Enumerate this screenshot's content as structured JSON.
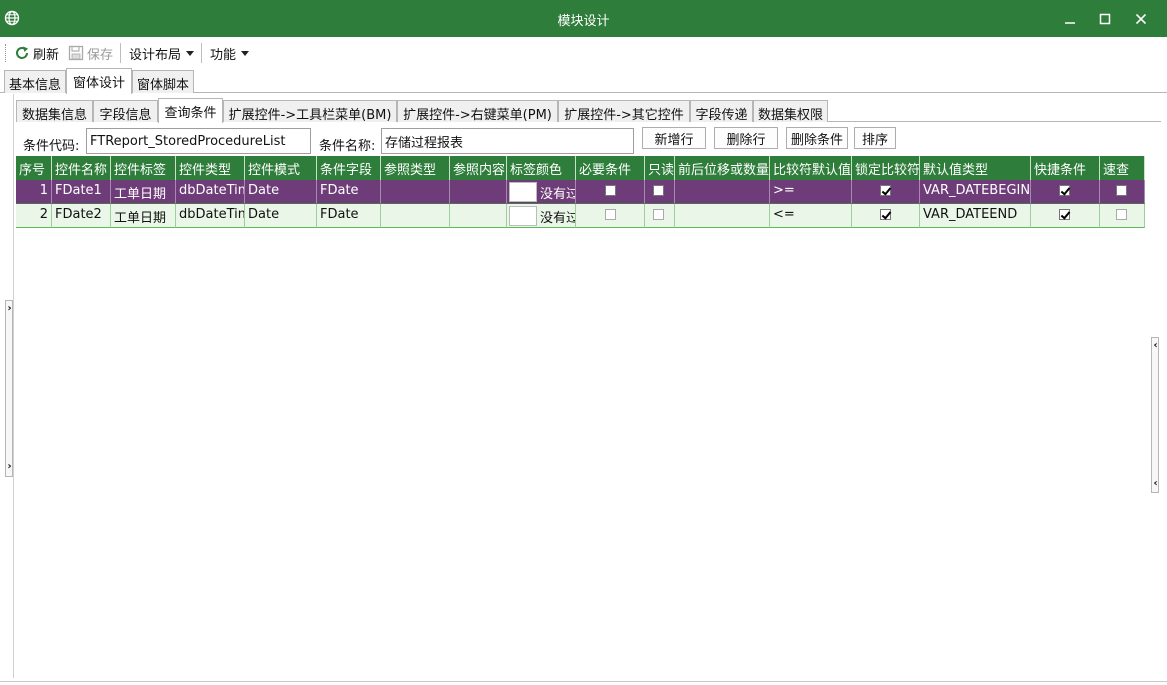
{
  "window": {
    "title": "模块设计"
  },
  "toolbar": {
    "refresh": "刷新",
    "save": "保存",
    "layout": "设计布局",
    "function": "功能"
  },
  "tabs_main": [
    "基本信息",
    "窗体设计",
    "窗体脚本"
  ],
  "tabs_sub": [
    "数据集信息",
    "字段信息",
    "查询条件",
    "扩展控件->工具栏菜单(BM)",
    "扩展控件->右键菜单(PM)",
    "扩展控件->其它控件",
    "字段传递",
    "数据集权限"
  ],
  "condition": {
    "code_label": "条件代码:",
    "code_value": "FTReport_StoredProcedureList",
    "name_label": "条件名称:",
    "name_value": "存储过程报表"
  },
  "buttons": {
    "add_row": "新增行",
    "delete_row": "删除行",
    "delete_condition": "删除条件",
    "sort": "排序"
  },
  "grid": {
    "columns": [
      "序号",
      "控件名称",
      "控件标签",
      "控件类型",
      "控件模式",
      "条件字段",
      "参照类型",
      "参照内容",
      "标签颜色",
      "必要条件",
      "只读",
      "前后位移或数量",
      "比较符默认值",
      "锁定比较符",
      "默认值类型",
      "快捷条件",
      "速查"
    ],
    "rows": [
      {
        "no": "1",
        "name": "FDate1",
        "label": "工单日期",
        "type": "dbDateTim",
        "mode": "Date",
        "field": "FDate",
        "ref_type": "",
        "ref_content": "",
        "color_text": "没有过",
        "required": false,
        "readonly": false,
        "offset": "",
        "compare": ">=",
        "lock_compare": true,
        "default_type": "VAR_DATEBEGIN",
        "quick": true,
        "lookup": false
      },
      {
        "no": "2",
        "name": "FDate2",
        "label": "工单日期",
        "type": "dbDateTim",
        "mode": "Date",
        "field": "FDate",
        "ref_type": "",
        "ref_content": "",
        "color_text": "没有过",
        "required": false,
        "readonly": false,
        "offset": "",
        "compare": "<=",
        "lock_compare": true,
        "default_type": "VAR_DATEEND",
        "quick": true,
        "lookup": false
      }
    ]
  }
}
